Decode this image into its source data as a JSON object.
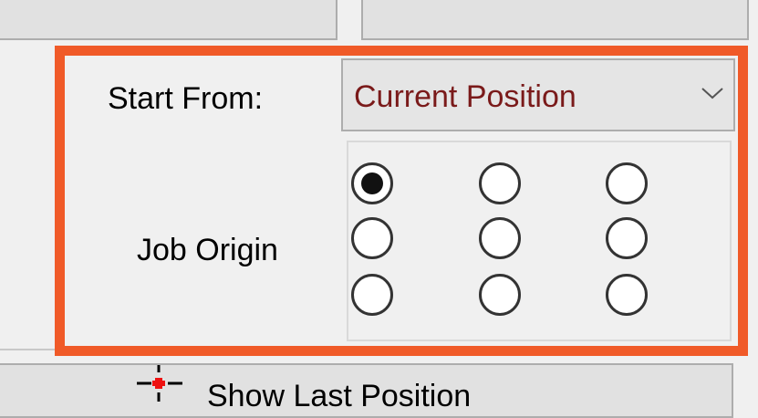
{
  "start_from": {
    "label": "Start From:",
    "selected": "Current Position"
  },
  "job_origin": {
    "label": "Job Origin",
    "options": [
      {
        "row": 1,
        "col": 1,
        "checked": true
      },
      {
        "row": 1,
        "col": 2,
        "checked": false
      },
      {
        "row": 1,
        "col": 3,
        "checked": false
      },
      {
        "row": 2,
        "col": 1,
        "checked": false
      },
      {
        "row": 2,
        "col": 2,
        "checked": false
      },
      {
        "row": 2,
        "col": 3,
        "checked": false
      },
      {
        "row": 3,
        "col": 1,
        "checked": false
      },
      {
        "row": 3,
        "col": 2,
        "checked": false
      },
      {
        "row": 3,
        "col": 3,
        "checked": false
      }
    ]
  },
  "show_last_position": {
    "label": "Show Last Position",
    "icon": "crosshair-icon"
  },
  "colors": {
    "highlight": "#f05a28",
    "combo_text": "#7a1a1a"
  }
}
